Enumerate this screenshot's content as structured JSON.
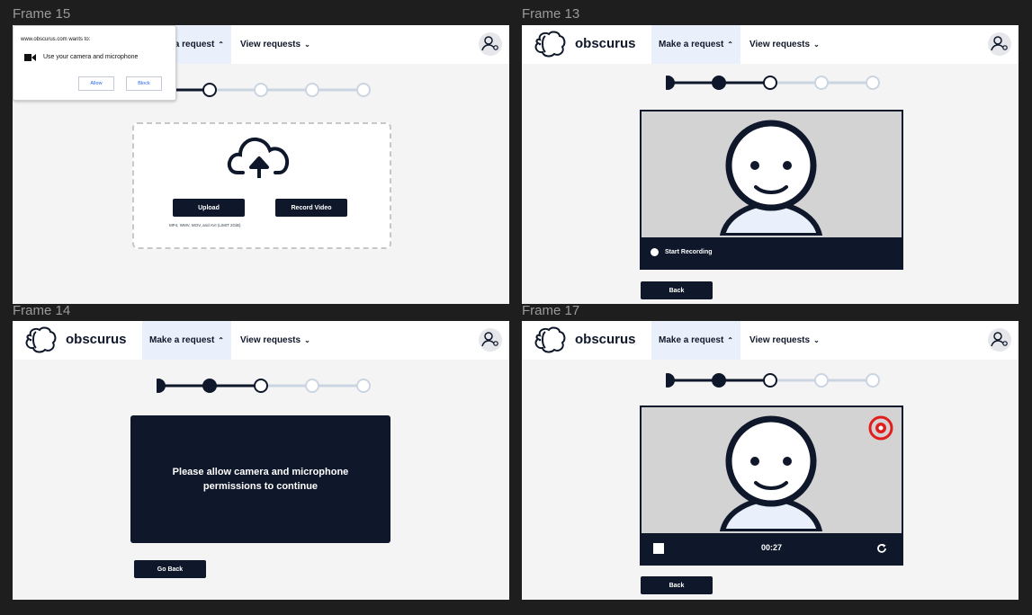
{
  "frames": {
    "f15": {
      "label": "Frame 15"
    },
    "f13": {
      "label": "Frame 13"
    },
    "f14": {
      "label": "Frame 14"
    },
    "f17": {
      "label": "Frame 17"
    }
  },
  "nav": {
    "brand": "obscurus",
    "make_request": "Make a request",
    "view_requests": "View requests",
    "caret_up": "⌃",
    "caret_down": "⌄"
  },
  "permission_popup": {
    "site_text": "www.obscurus.com wants to:",
    "request_text": "Use your camera and microphone",
    "allow_label": "Allow",
    "block_label": "Block"
  },
  "upload": {
    "upload_label": "Upload",
    "record_label": "Record Video",
    "formats_text": "MP4, WMV, MOV, and AVI (LIMIT 2GiB)"
  },
  "recorder": {
    "start_label": "Start Recording",
    "back_label": "Back",
    "timer": "00:27"
  },
  "permission_needed": {
    "line1": "Please allow camera and microphone",
    "line2": "permissions to continue",
    "go_back_label": "Go Back"
  },
  "colors": {
    "navy": "#0f172a",
    "nav_highlight": "#e9f0fb",
    "record_red": "#e11d1d",
    "step_inactive": "#cbd5e1"
  },
  "stepper": {
    "total_steps": 5,
    "current_step": 3
  }
}
